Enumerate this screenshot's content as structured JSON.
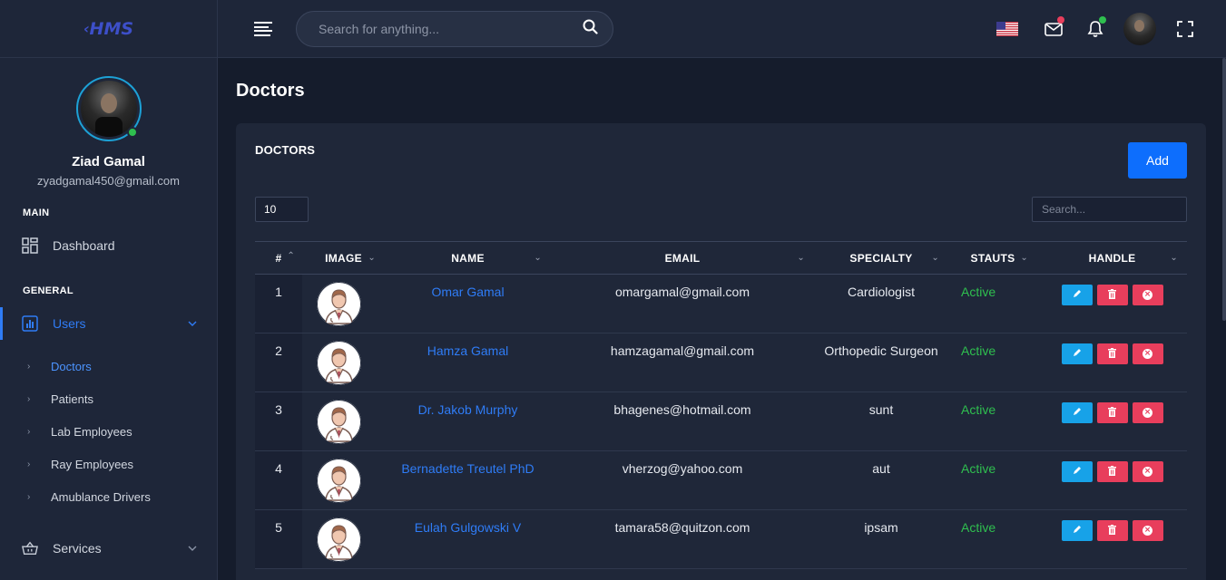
{
  "app": {
    "logo_text": "HMS"
  },
  "profile": {
    "name": "Ziad Gamal",
    "email": "zyadgamal450@gmail.com"
  },
  "sidebar": {
    "main_label": "MAIN",
    "general_label": "GENERAL",
    "dashboard": "Dashboard",
    "users": "Users",
    "services": "Services",
    "sub_items": [
      "Doctors",
      "Patients",
      "Lab Employees",
      "Ray Employees",
      "Amublance Drivers"
    ]
  },
  "topbar": {
    "search_placeholder": "Search for anything..."
  },
  "page": {
    "title": "Doctors",
    "card_title": "DOCTORS",
    "add_label": "Add",
    "page_size": "10",
    "table_search_placeholder": "Search..."
  },
  "table": {
    "headers": [
      "#",
      "IMAGE",
      "NAME",
      "EMAIL",
      "SPECIALTY",
      "STAUTS",
      "HANDLE"
    ],
    "rows": [
      {
        "idx": "1",
        "name": "Omar Gamal",
        "email": "omargamal@gmail.com",
        "specialty": "Cardiologist",
        "status": "Active"
      },
      {
        "idx": "2",
        "name": "Hamza Gamal",
        "email": "hamzagamal@gmail.com",
        "specialty": "Orthopedic Surgeon",
        "status": "Active"
      },
      {
        "idx": "3",
        "name": "Dr. Jakob Murphy",
        "email": "bhagenes@hotmail.com",
        "specialty": "sunt",
        "status": "Active"
      },
      {
        "idx": "4",
        "name": "Bernadette Treutel PhD",
        "email": "vherzog@yahoo.com",
        "specialty": "aut",
        "status": "Active"
      },
      {
        "idx": "5",
        "name": "Eulah Gulgowski V",
        "email": "tamara58@quitzon.com",
        "specialty": "ipsam",
        "status": "Active"
      }
    ]
  },
  "colors": {
    "accent": "#0d6efd",
    "active_status": "#2fbf4f",
    "edit": "#17a2e8",
    "delete": "#e83e5c"
  }
}
